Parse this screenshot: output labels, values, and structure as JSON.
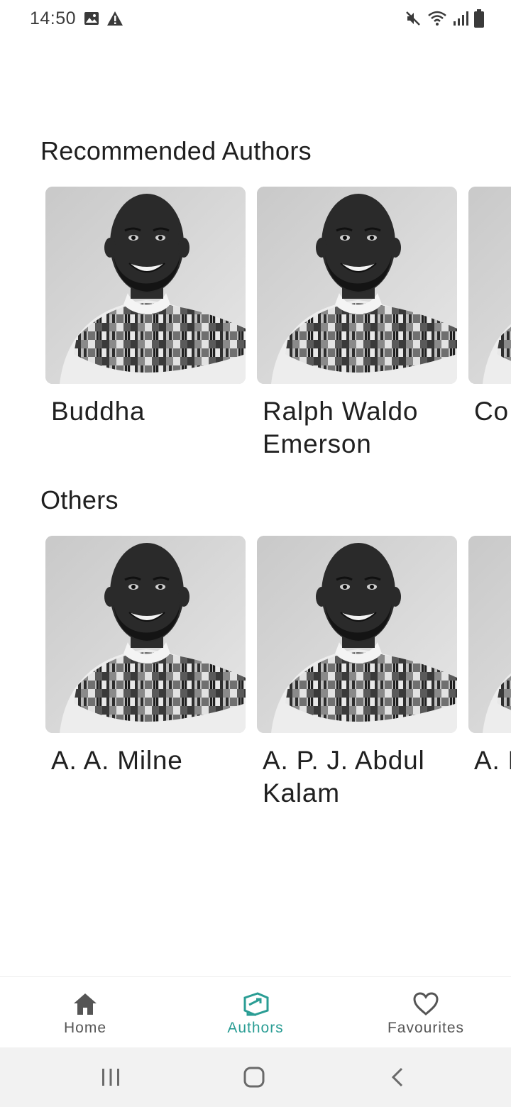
{
  "status_bar": {
    "time": "14:50",
    "left_icons": [
      "image-icon",
      "alert-icon"
    ],
    "right_icons": [
      "mute-icon",
      "wifi-icon",
      "signal-icon",
      "battery-icon"
    ]
  },
  "sections": [
    {
      "title": "Recommended Authors",
      "authors": [
        "Buddha",
        "Ralph Waldo Emerson",
        "Co"
      ]
    },
    {
      "title": "Others",
      "authors": [
        "A. A. Milne",
        "A. P. J. Abdul Kalam",
        "A. Da"
      ]
    }
  ],
  "bottom_nav": {
    "items": [
      {
        "label": "Home",
        "icon": "home-icon",
        "active": false
      },
      {
        "label": "Authors",
        "icon": "authors-icon",
        "active": true
      },
      {
        "label": "Favourites",
        "icon": "heart-icon",
        "active": false
      }
    ],
    "active_color": "#2a9d94",
    "inactive_color": "#555555"
  },
  "system_nav": {
    "buttons": [
      "recents-icon",
      "home-circle-icon",
      "back-icon"
    ]
  }
}
